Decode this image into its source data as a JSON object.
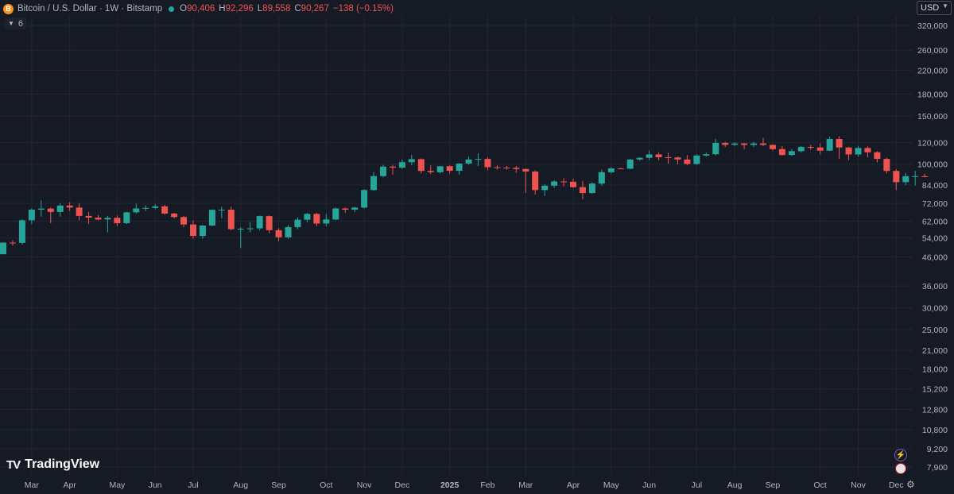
{
  "header": {
    "currency_icon": "B",
    "symbol": "Bitcoin / U.S. Dollar · 1W · Bitstamp",
    "open_label": "O",
    "open": "90,406",
    "high_label": "H",
    "high": "92,296",
    "low_label": "L",
    "low": "89,558",
    "close_label": "C",
    "close": "90,267",
    "change": "−138 (−0.15%)",
    "indicators_count": "6"
  },
  "currency_selector": {
    "label": "USD"
  },
  "branding": {
    "name": "TradingView"
  },
  "chart_data": {
    "type": "candlestick",
    "y_scale": "log",
    "ylim": [
      7000,
      350000
    ],
    "y_ticks": [
      320000,
      260000,
      220000,
      180000,
      150000,
      120000,
      100000,
      84000,
      72000,
      62000,
      54000,
      46000,
      36000,
      30000,
      25000,
      21000,
      18000,
      15200,
      12800,
      10800,
      9200,
      7900
    ],
    "y_tick_labels": [
      "320,000",
      "260,000",
      "220,000",
      "180,000",
      "150,000",
      "120,000",
      "100,000",
      "84,000",
      "72,000",
      "62,000",
      "54,000",
      "46,000",
      "36,000",
      "30,000",
      "25,000",
      "21,000",
      "18,000",
      "15,200",
      "12,800",
      "10,800",
      "9,200",
      "7,900"
    ],
    "x_ticks": [
      {
        "label": "Mar",
        "i": 3
      },
      {
        "label": "Apr",
        "i": 7
      },
      {
        "label": "May",
        "i": 12
      },
      {
        "label": "Jun",
        "i": 16
      },
      {
        "label": "Jul",
        "i": 20
      },
      {
        "label": "Aug",
        "i": 25
      },
      {
        "label": "Sep",
        "i": 29
      },
      {
        "label": "Oct",
        "i": 34
      },
      {
        "label": "Nov",
        "i": 38
      },
      {
        "label": "Dec",
        "i": 42
      },
      {
        "label": "2025",
        "i": 47
      },
      {
        "label": "Feb",
        "i": 51
      },
      {
        "label": "Mar",
        "i": 55
      },
      {
        "label": "Apr",
        "i": 60
      },
      {
        "label": "May",
        "i": 64
      },
      {
        "label": "Jun",
        "i": 68
      },
      {
        "label": "Jul",
        "i": 73
      },
      {
        "label": "Aug",
        "i": 77
      },
      {
        "label": "Sep",
        "i": 81
      },
      {
        "label": "Oct",
        "i": 86
      },
      {
        "label": "Nov",
        "i": 90
      },
      {
        "label": "Dec",
        "i": 94
      }
    ],
    "candles": [
      {
        "o": 47000,
        "h": 52000,
        "l": 47000,
        "c": 51800
      },
      {
        "o": 51800,
        "h": 52800,
        "l": 50500,
        "c": 51700
      },
      {
        "o": 51700,
        "h": 63000,
        "l": 51000,
        "c": 62500
      },
      {
        "o": 62500,
        "h": 69000,
        "l": 60500,
        "c": 68300
      },
      {
        "o": 68300,
        "h": 73800,
        "l": 64500,
        "c": 68900
      },
      {
        "o": 68900,
        "h": 69500,
        "l": 61000,
        "c": 67000
      },
      {
        "o": 67000,
        "h": 72000,
        "l": 64500,
        "c": 70700
      },
      {
        "o": 70700,
        "h": 72700,
        "l": 67500,
        "c": 69500
      },
      {
        "o": 69500,
        "h": 72000,
        "l": 62500,
        "c": 64800
      },
      {
        "o": 64800,
        "h": 67000,
        "l": 60500,
        "c": 63900
      },
      {
        "o": 63900,
        "h": 65300,
        "l": 62500,
        "c": 62900
      },
      {
        "o": 62900,
        "h": 64800,
        "l": 56500,
        "c": 63800
      },
      {
        "o": 63800,
        "h": 65000,
        "l": 59500,
        "c": 61000
      },
      {
        "o": 61000,
        "h": 67000,
        "l": 60500,
        "c": 66800
      },
      {
        "o": 66800,
        "h": 71800,
        "l": 66000,
        "c": 69000
      },
      {
        "o": 69000,
        "h": 70800,
        "l": 67500,
        "c": 69300
      },
      {
        "o": 69300,
        "h": 71500,
        "l": 68500,
        "c": 70200
      },
      {
        "o": 70200,
        "h": 71000,
        "l": 65500,
        "c": 66100
      },
      {
        "o": 66100,
        "h": 66500,
        "l": 63500,
        "c": 64200
      },
      {
        "o": 64200,
        "h": 64800,
        "l": 59000,
        "c": 60300
      },
      {
        "o": 60300,
        "h": 62500,
        "l": 53500,
        "c": 54800
      },
      {
        "o": 54800,
        "h": 60000,
        "l": 53500,
        "c": 59800
      },
      {
        "o": 59800,
        "h": 68500,
        "l": 59500,
        "c": 68200
      },
      {
        "o": 68200,
        "h": 70000,
        "l": 63500,
        "c": 68300
      },
      {
        "o": 68300,
        "h": 70000,
        "l": 57500,
        "c": 58000
      },
      {
        "o": 58000,
        "h": 59000,
        "l": 49500,
        "c": 58200
      },
      {
        "o": 58200,
        "h": 61500,
        "l": 56500,
        "c": 58400
      },
      {
        "o": 58400,
        "h": 65000,
        "l": 57500,
        "c": 64700
      },
      {
        "o": 64700,
        "h": 65000,
        "l": 56000,
        "c": 57500
      },
      {
        "o": 57500,
        "h": 58500,
        "l": 52500,
        "c": 54200
      },
      {
        "o": 54200,
        "h": 60000,
        "l": 53500,
        "c": 59000
      },
      {
        "o": 59000,
        "h": 64000,
        "l": 58000,
        "c": 62800
      },
      {
        "o": 62800,
        "h": 66500,
        "l": 61500,
        "c": 65900
      },
      {
        "o": 65900,
        "h": 66500,
        "l": 59500,
        "c": 60800
      },
      {
        "o": 60800,
        "h": 65800,
        "l": 59500,
        "c": 62900
      },
      {
        "o": 62900,
        "h": 69500,
        "l": 62500,
        "c": 69000
      },
      {
        "o": 69000,
        "h": 69500,
        "l": 66500,
        "c": 68300
      },
      {
        "o": 68300,
        "h": 70000,
        "l": 67000,
        "c": 69500
      },
      {
        "o": 69500,
        "h": 81000,
        "l": 69000,
        "c": 80500
      },
      {
        "o": 80500,
        "h": 93500,
        "l": 80000,
        "c": 90500
      },
      {
        "o": 90500,
        "h": 99500,
        "l": 89500,
        "c": 98000
      },
      {
        "o": 98000,
        "h": 99500,
        "l": 91500,
        "c": 97200
      },
      {
        "o": 97200,
        "h": 104000,
        "l": 96000,
        "c": 101700
      },
      {
        "o": 101700,
        "h": 108000,
        "l": 99000,
        "c": 104300
      },
      {
        "o": 104300,
        "h": 105000,
        "l": 92500,
        "c": 94500
      },
      {
        "o": 94500,
        "h": 99000,
        "l": 92000,
        "c": 93500
      },
      {
        "o": 93500,
        "h": 98500,
        "l": 92500,
        "c": 98300
      },
      {
        "o": 98300,
        "h": 99000,
        "l": 92500,
        "c": 94600
      },
      {
        "o": 94600,
        "h": 101000,
        "l": 91500,
        "c": 100500
      },
      {
        "o": 100500,
        "h": 106500,
        "l": 99500,
        "c": 104000
      },
      {
        "o": 104000,
        "h": 109500,
        "l": 98500,
        "c": 104500
      },
      {
        "o": 104500,
        "h": 106000,
        "l": 95000,
        "c": 97500
      },
      {
        "o": 97500,
        "h": 99000,
        "l": 95500,
        "c": 97200
      },
      {
        "o": 97200,
        "h": 98500,
        "l": 95500,
        "c": 97000
      },
      {
        "o": 97000,
        "h": 98500,
        "l": 93000,
        "c": 96000
      },
      {
        "o": 96000,
        "h": 96500,
        "l": 78500,
        "c": 94000
      },
      {
        "o": 94000,
        "h": 95000,
        "l": 77500,
        "c": 80500
      },
      {
        "o": 80500,
        "h": 84500,
        "l": 76500,
        "c": 83500
      },
      {
        "o": 83500,
        "h": 87500,
        "l": 82000,
        "c": 86500
      },
      {
        "o": 86500,
        "h": 89000,
        "l": 83000,
        "c": 86300
      },
      {
        "o": 86300,
        "h": 88500,
        "l": 82000,
        "c": 82500
      },
      {
        "o": 82500,
        "h": 87000,
        "l": 74500,
        "c": 78500
      },
      {
        "o": 78500,
        "h": 86000,
        "l": 78000,
        "c": 85000
      },
      {
        "o": 85000,
        "h": 95500,
        "l": 83500,
        "c": 93500
      },
      {
        "o": 93500,
        "h": 97500,
        "l": 92500,
        "c": 96500
      },
      {
        "o": 96500,
        "h": 97000,
        "l": 96000,
        "c": 96300
      },
      {
        "o": 96300,
        "h": 104500,
        "l": 96000,
        "c": 104000
      },
      {
        "o": 104000,
        "h": 106000,
        "l": 103000,
        "c": 105500
      },
      {
        "o": 105500,
        "h": 112000,
        "l": 103500,
        "c": 108500
      },
      {
        "o": 108500,
        "h": 110500,
        "l": 103500,
        "c": 106000
      },
      {
        "o": 106000,
        "h": 110000,
        "l": 100500,
        "c": 105800
      },
      {
        "o": 105800,
        "h": 106500,
        "l": 100000,
        "c": 104000
      },
      {
        "o": 104000,
        "h": 108000,
        "l": 99000,
        "c": 100200
      },
      {
        "o": 100200,
        "h": 108500,
        "l": 99500,
        "c": 107500
      },
      {
        "o": 107500,
        "h": 110500,
        "l": 106500,
        "c": 108700
      },
      {
        "o": 108700,
        "h": 123500,
        "l": 107500,
        "c": 119500
      },
      {
        "o": 119500,
        "h": 120500,
        "l": 115500,
        "c": 117600
      },
      {
        "o": 117600,
        "h": 120000,
        "l": 116500,
        "c": 119000
      },
      {
        "o": 119000,
        "h": 119500,
        "l": 113500,
        "c": 117500
      },
      {
        "o": 117500,
        "h": 120500,
        "l": 115500,
        "c": 119000
      },
      {
        "o": 119000,
        "h": 124500,
        "l": 116500,
        "c": 117500
      },
      {
        "o": 117500,
        "h": 118000,
        "l": 112000,
        "c": 113500
      },
      {
        "o": 113500,
        "h": 116500,
        "l": 107500,
        "c": 108000
      },
      {
        "o": 108000,
        "h": 113500,
        "l": 107000,
        "c": 111500
      },
      {
        "o": 111500,
        "h": 116500,
        "l": 110500,
        "c": 115500
      },
      {
        "o": 115500,
        "h": 117500,
        "l": 113000,
        "c": 115000
      },
      {
        "o": 115000,
        "h": 119000,
        "l": 108500,
        "c": 112000
      },
      {
        "o": 112000,
        "h": 126000,
        "l": 111500,
        "c": 123500
      },
      {
        "o": 123500,
        "h": 126500,
        "l": 104500,
        "c": 115000
      },
      {
        "o": 115000,
        "h": 115500,
        "l": 103500,
        "c": 108500
      },
      {
        "o": 108500,
        "h": 116500,
        "l": 106500,
        "c": 114500
      },
      {
        "o": 114500,
        "h": 116000,
        "l": 106000,
        "c": 110500
      },
      {
        "o": 110500,
        "h": 111500,
        "l": 101500,
        "c": 104500
      },
      {
        "o": 104500,
        "h": 105500,
        "l": 92500,
        "c": 94500
      },
      {
        "o": 94500,
        "h": 96000,
        "l": 80500,
        "c": 86000
      },
      {
        "o": 86000,
        "h": 93000,
        "l": 84000,
        "c": 90400
      },
      {
        "o": 90400,
        "h": 94500,
        "l": 83500,
        "c": 90406
      },
      {
        "o": 90406,
        "h": 92296,
        "l": 89558,
        "c": 90267
      }
    ],
    "colors": {
      "up": "#26a69a",
      "down": "#ef5350",
      "grid": "#232631",
      "axis_text": "#b2b5be",
      "background": "#161a25"
    }
  }
}
